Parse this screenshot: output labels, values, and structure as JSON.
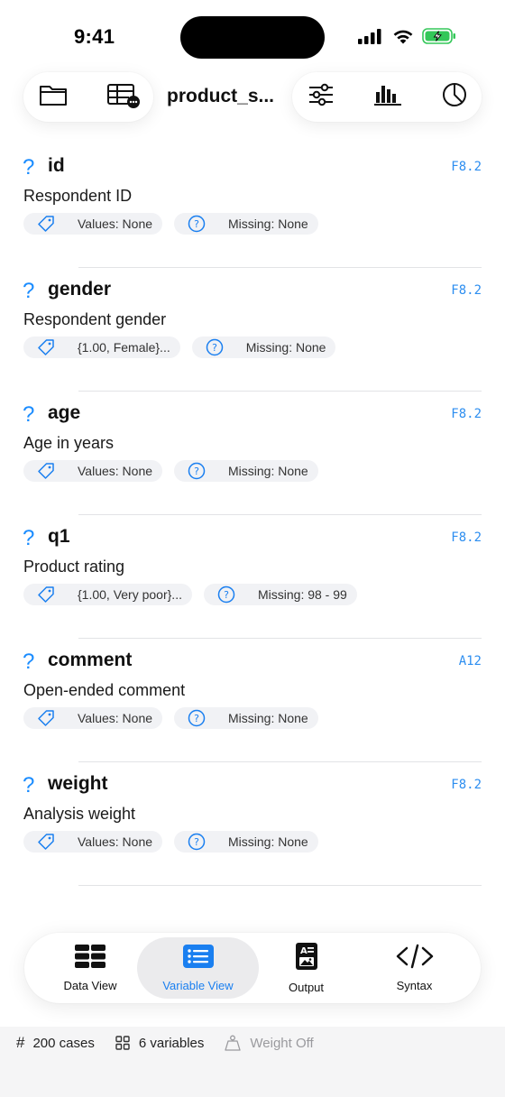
{
  "status": {
    "time": "9:41"
  },
  "toolbar": {
    "title": "product_s...",
    "icons": [
      "folder-icon",
      "table-more-icon",
      "sliders-icon",
      "bar-chart-icon",
      "pie-chart-icon"
    ]
  },
  "variables": [
    {
      "name": "id",
      "label": "Respondent ID",
      "format": "F8.2",
      "values": "Values: None",
      "missing": "Missing: None"
    },
    {
      "name": "gender",
      "label": "Respondent gender",
      "format": "F8.2",
      "values": "{1.00, Female}...",
      "missing": "Missing: None"
    },
    {
      "name": "age",
      "label": "Age in years",
      "format": "F8.2",
      "values": "Values: None",
      "missing": "Missing: None"
    },
    {
      "name": "q1",
      "label": "Product rating",
      "format": "F8.2",
      "values": "{1.00, Very poor}...",
      "missing": "Missing: 98 - 99"
    },
    {
      "name": "comment",
      "label": "Open-ended comment",
      "format": "A12",
      "values": "Values: None",
      "missing": "Missing: None"
    },
    {
      "name": "weight",
      "label": "Analysis weight",
      "format": "F8.2",
      "values": "Values: None",
      "missing": "Missing: None"
    }
  ],
  "var_mark": "?",
  "tabs": [
    {
      "label": "Data View",
      "icon": "grid-icon",
      "active": false
    },
    {
      "label": "Variable View",
      "icon": "list-icon",
      "active": true
    },
    {
      "label": "Output",
      "icon": "output-doc-icon",
      "active": false
    },
    {
      "label": "Syntax",
      "icon": "code-icon",
      "active": false
    }
  ],
  "footer": {
    "cases_icon": "#",
    "cases": "200 cases",
    "variables": "6 variables",
    "weight": "Weight Off"
  },
  "colors": {
    "accent": "#1a7ff0",
    "format": "#2d8ef0",
    "chip_bg": "#f1f2f5",
    "battery": "#34c759"
  }
}
